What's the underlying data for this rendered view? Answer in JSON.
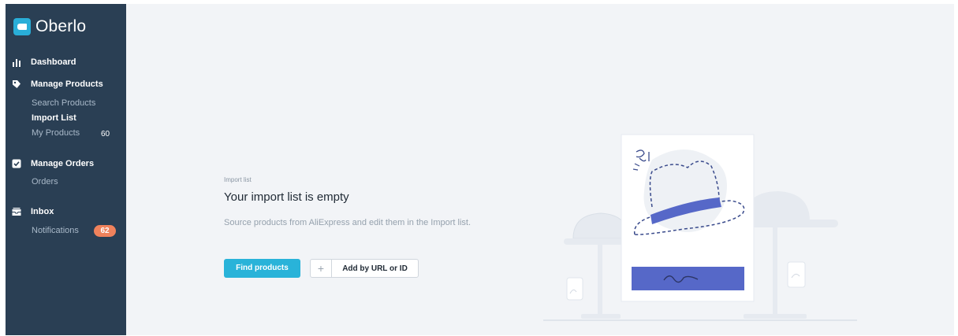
{
  "app": {
    "logo_text": "Oberlo",
    "brand_color": "#29aed8",
    "sidebar_color": "#2a3f54",
    "accent_badge_color": "#f0825c"
  },
  "sidebar": {
    "dashboard": {
      "label": "Dashboard",
      "icon": "bar-chart-icon"
    },
    "manage_products": {
      "label": "Manage Products",
      "icon": "tag-icon",
      "items": [
        {
          "label": "Search Products"
        },
        {
          "label": "Import List",
          "active": true
        },
        {
          "label": "My Products",
          "count": "60"
        }
      ]
    },
    "manage_orders": {
      "label": "Manage Orders",
      "icon": "checkbox-icon",
      "items": [
        {
          "label": "Orders"
        }
      ]
    },
    "inbox": {
      "label": "Inbox",
      "icon": "inbox-icon",
      "items": [
        {
          "label": "Notifications",
          "badge": "62"
        }
      ]
    }
  },
  "main": {
    "eyebrow": "Import list",
    "title": "Your import list is empty",
    "description": "Source products from AliExpress and edit them in the Import list.",
    "primary_button": "Find products",
    "secondary_button": "Add by URL or ID",
    "secondary_icon": "plus-icon"
  }
}
